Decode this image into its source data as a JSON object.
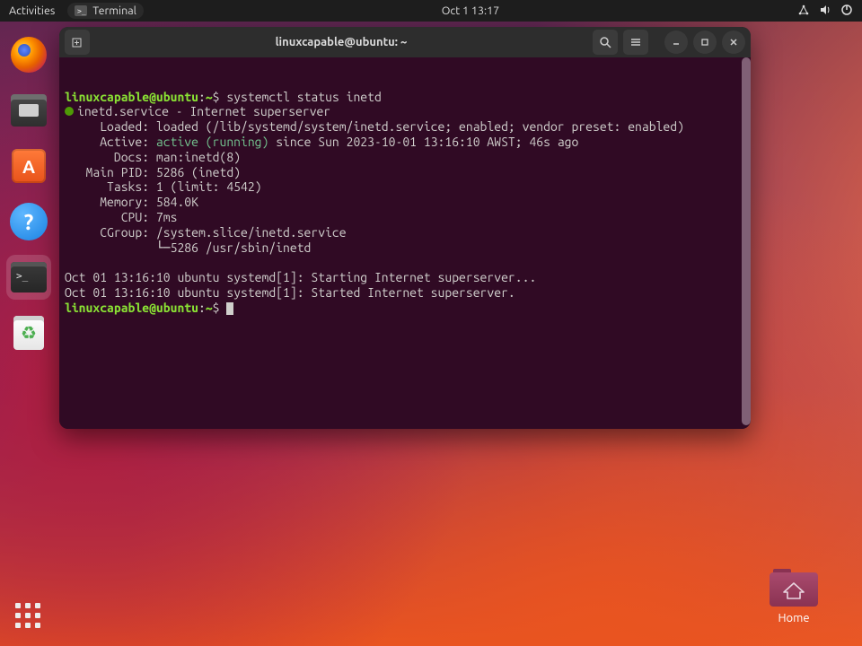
{
  "panel": {
    "activities": "Activities",
    "app_label": "Terminal",
    "clock": "Oct 1  13:17"
  },
  "dock": {
    "running_indicator": "terminal"
  },
  "terminal": {
    "title": "linuxcapable@ubuntu: ~",
    "prompt_user_host": "linuxcapable@ubuntu",
    "prompt_path": "~",
    "prompt_symbol": "$",
    "command": "systemctl status inetd",
    "service_header": "inetd.service - Internet superserver",
    "loaded": "     Loaded: loaded (/lib/systemd/system/inetd.service; enabled; vendor preset: enabled)",
    "active_prefix": "     Active: ",
    "active_green": "active (running)",
    "active_rest": " since Sun 2023-10-01 13:16:10 AWST; 46s ago",
    "docs": "       Docs: man:inetd(8)",
    "mainpid": "   Main PID: 5286 (inetd)",
    "tasks": "      Tasks: 1 (limit: 4542)",
    "memory": "     Memory: 584.0K",
    "cpu": "        CPU: 7ms",
    "cgroup": "     CGroup: /system.slice/inetd.service",
    "cgroup2": "             └─5286 /usr/sbin/inetd",
    "log1": "Oct 01 13:16:10 ubuntu systemd[1]: Starting Internet superserver...",
    "log2": "Oct 01 13:16:10 ubuntu systemd[1]: Started Internet superserver."
  },
  "desktop": {
    "home_label": "Home"
  }
}
